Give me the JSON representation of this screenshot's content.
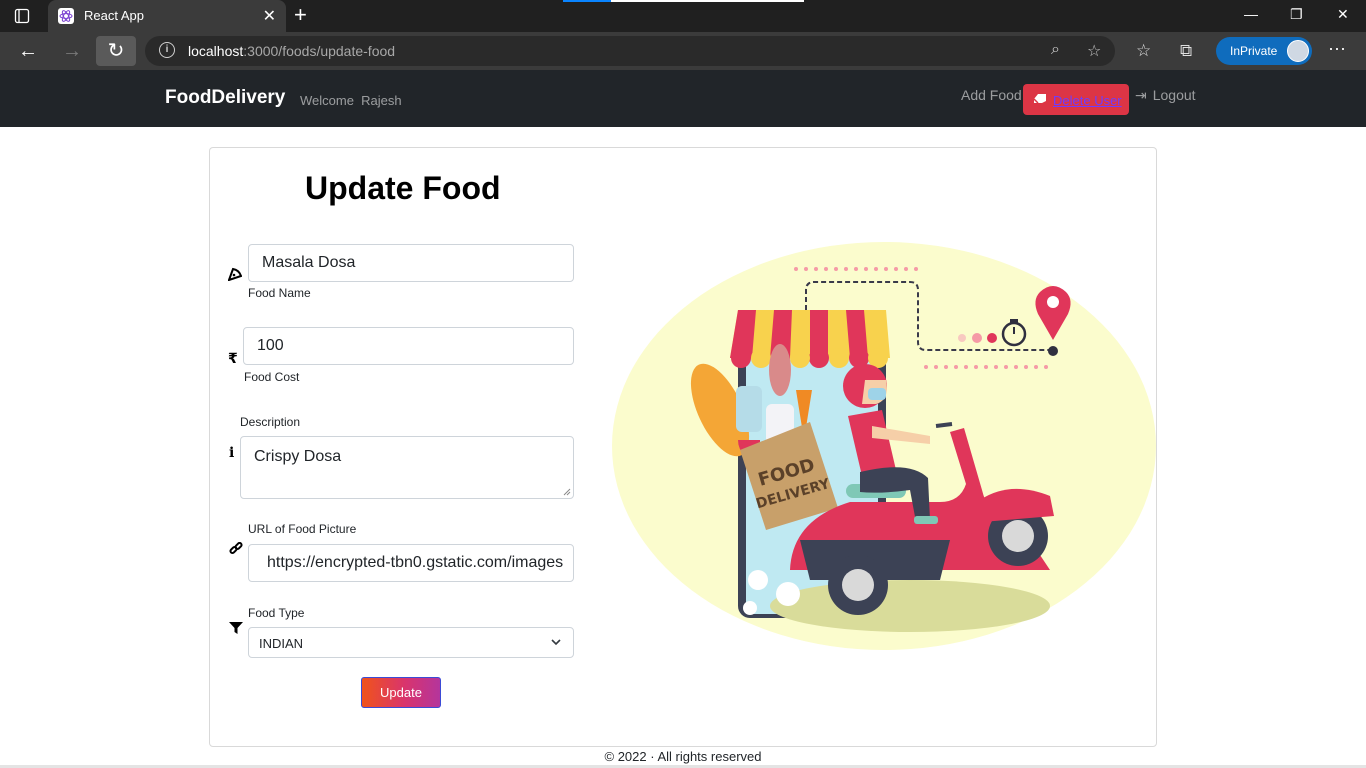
{
  "browser": {
    "tab_title": "React App",
    "url_host": "localhost",
    "url_rest": ":3000/foods/update-food",
    "inprivate_label": "InPrivate"
  },
  "navbar": {
    "brand": "FoodDelivery",
    "welcome": "Welcome  Rajesh",
    "add_food": "Add Food",
    "delete_user": "Delete User",
    "logout": "Logout"
  },
  "form": {
    "heading": "Update Food",
    "food_name": {
      "value": "Masala Dosa",
      "label": "Food Name"
    },
    "food_cost": {
      "value": "100",
      "label": "Food Cost"
    },
    "description": {
      "label": "Description",
      "value": "Crispy Dosa"
    },
    "picture_url": {
      "label": "URL of Food Picture",
      "value": "https://encrypted-tbn0.gstatic.com/images"
    },
    "food_type": {
      "label": "Food Type",
      "selected": "INDIAN"
    },
    "submit_label": "Update"
  },
  "illustration": {
    "bag_text_line1": "FOOD",
    "bag_text_line2": "DELIVERY"
  },
  "footer": {
    "text": "© 2022 · All rights reserved"
  }
}
